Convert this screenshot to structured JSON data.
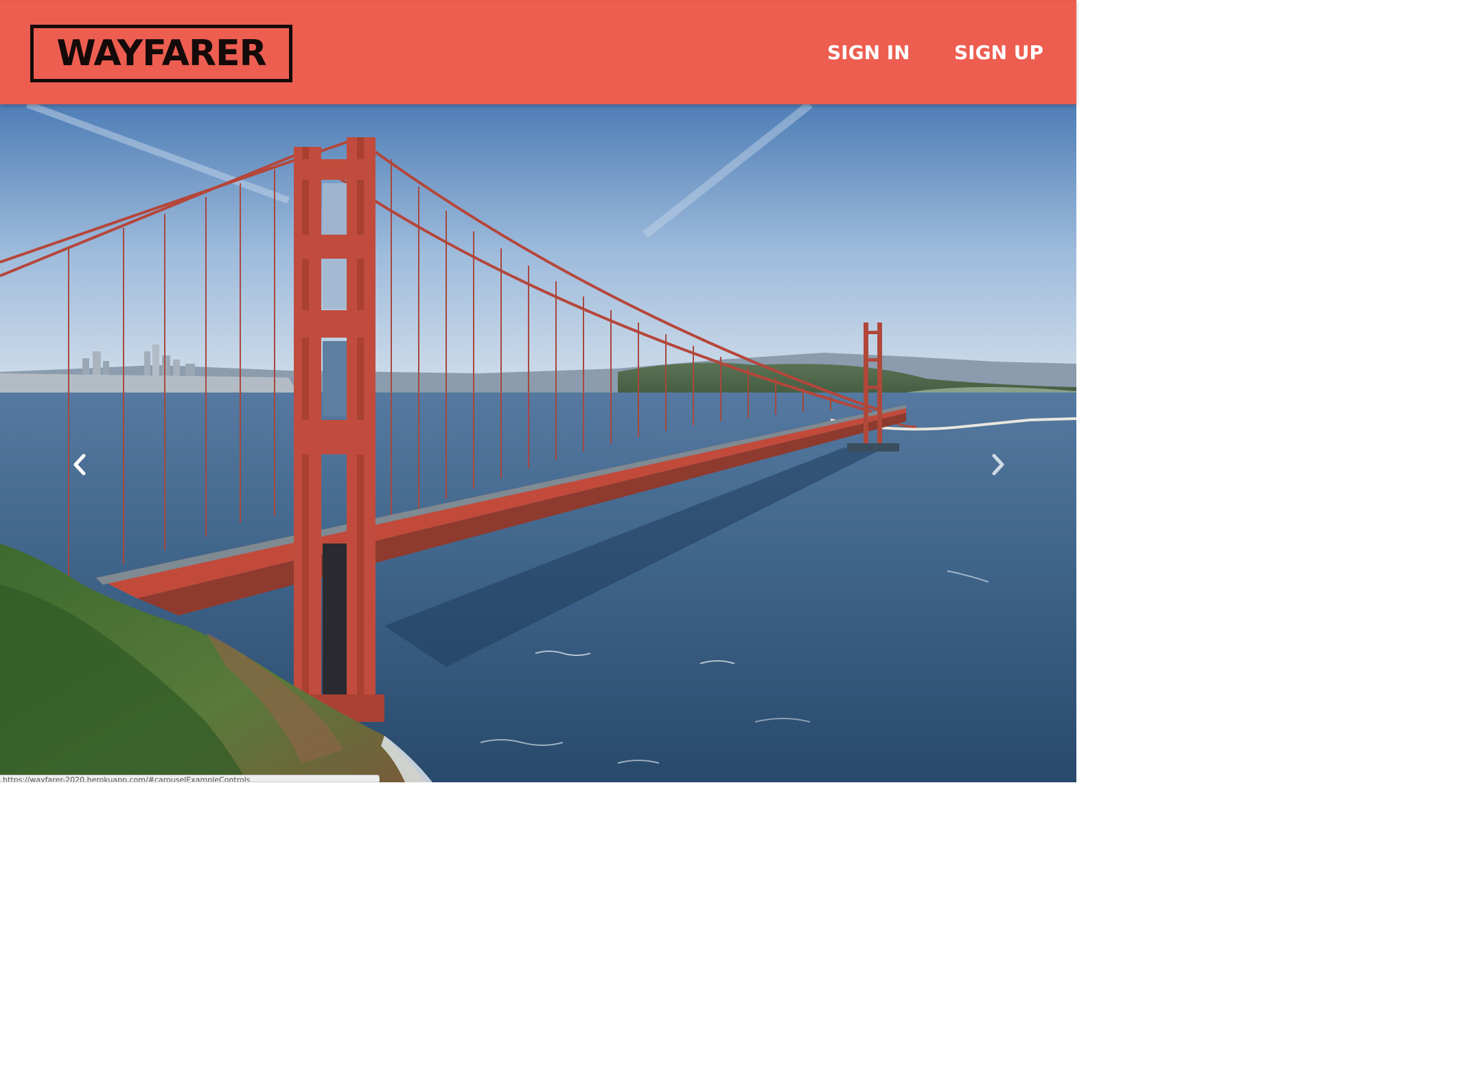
{
  "navbar": {
    "brand": "WAYFARER",
    "links": {
      "sign_in": "SIGN IN",
      "sign_up": "SIGN UP"
    },
    "background_color": "#ed5e50",
    "brand_color": "#140a0a"
  },
  "carousel": {
    "slide_image": "golden-gate-bridge-photo",
    "prev_icon": "chevron-left-icon",
    "next_icon": "chevron-right-icon"
  },
  "status_bar": {
    "url": "https://wayfarer-2020.herokuapp.com/#carouselExampleControls"
  }
}
